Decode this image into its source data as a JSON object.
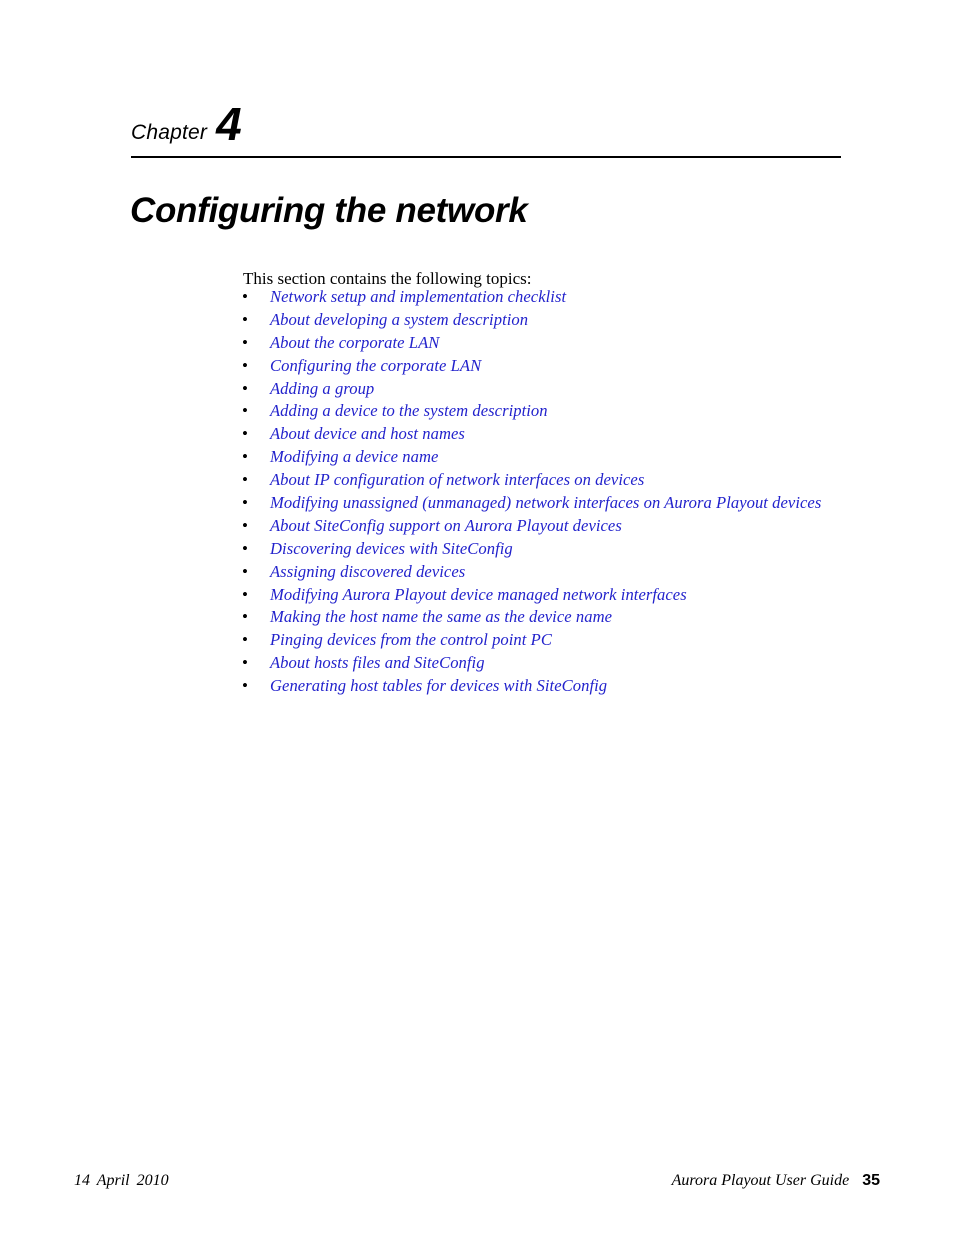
{
  "page": {
    "background_color": "#ffffff",
    "link_color": "#2222cc",
    "text_color": "#000000"
  },
  "header": {
    "chapter_word": "Chapter",
    "chapter_number": "4",
    "title": "Configuring the network"
  },
  "body": {
    "intro": "This section contains the following topics:",
    "bullet_glyph": "•",
    "topics": [
      {
        "label": "Network setup and implementation checklist"
      },
      {
        "label": "About developing a system description"
      },
      {
        "label": "About the corporate LAN"
      },
      {
        "label": "Configuring the corporate LAN"
      },
      {
        "label": "Adding a group"
      },
      {
        "label": "Adding a device to the system description"
      },
      {
        "label": "About device and host names"
      },
      {
        "label": "Modifying a device name"
      },
      {
        "label": "About IP configuration of network interfaces on devices"
      },
      {
        "label": "Modifying unassigned (unmanaged) network interfaces on Aurora Playout devices"
      },
      {
        "label": "About SiteConfig support on Aurora Playout devices"
      },
      {
        "label": "Discovering devices with SiteConfig"
      },
      {
        "label": "Assigning discovered devices"
      },
      {
        "label": "Modifying Aurora Playout device managed network interfaces"
      },
      {
        "label": "Making the host name the same as the device name"
      },
      {
        "label": "Pinging devices from the control point PC"
      },
      {
        "label": "About hosts files and SiteConfig"
      },
      {
        "label": "Generating host tables for devices with SiteConfig"
      }
    ]
  },
  "footer": {
    "date": "14  April  2010",
    "guide_title": "Aurora Playout User Guide",
    "page_number": "35"
  }
}
